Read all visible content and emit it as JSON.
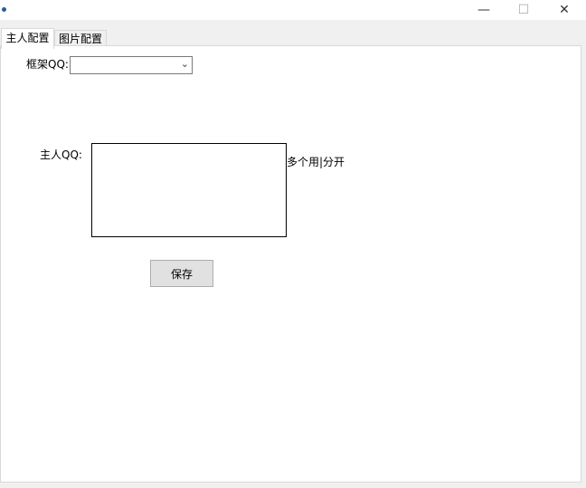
{
  "window": {
    "minimize_icon": "—",
    "maximize_icon": "☐",
    "close_icon": "✕"
  },
  "tabs": [
    {
      "label": "主人配置",
      "active": true
    },
    {
      "label": "图片配置",
      "active": false
    }
  ],
  "form": {
    "frame_qq_label": "框架QQ:",
    "frame_qq_value": "",
    "owner_qq_label": "主人QQ:",
    "owner_qq_value": "",
    "hint": "多个用|分开",
    "save_label": "保存"
  }
}
